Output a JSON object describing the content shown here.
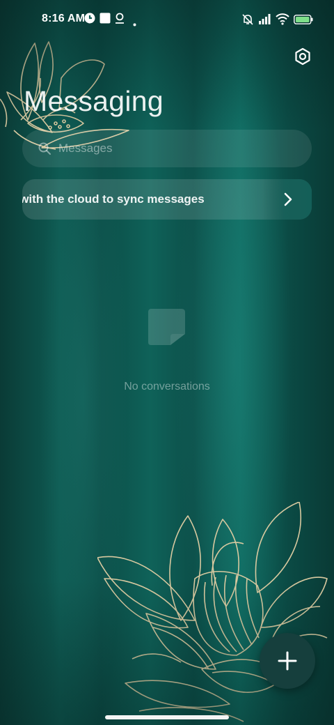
{
  "status_bar": {
    "time": "8:16 AM",
    "icons": [
      "app-icon-c",
      "square-notification-icon",
      "location-pin-icon",
      "dot-icon",
      "muted-bell-icon",
      "signal-icon",
      "wifi-icon",
      "battery-icon"
    ]
  },
  "header": {
    "title": "Messaging",
    "settings_icon": "settings-hexagon-icon"
  },
  "search": {
    "placeholder": "Messages",
    "icon": "search-icon"
  },
  "sync_banner": {
    "text": "Turn on sync with the cloud to sync messages",
    "icon": "chevron-right-icon"
  },
  "empty_state": {
    "text": "No conversations",
    "icon": "empty-chat-icon"
  },
  "fab": {
    "icon": "plus-icon"
  },
  "colors": {
    "background": "#0e5a52",
    "fab": "#163f3d",
    "lotus_line": "#d8c9a0"
  }
}
